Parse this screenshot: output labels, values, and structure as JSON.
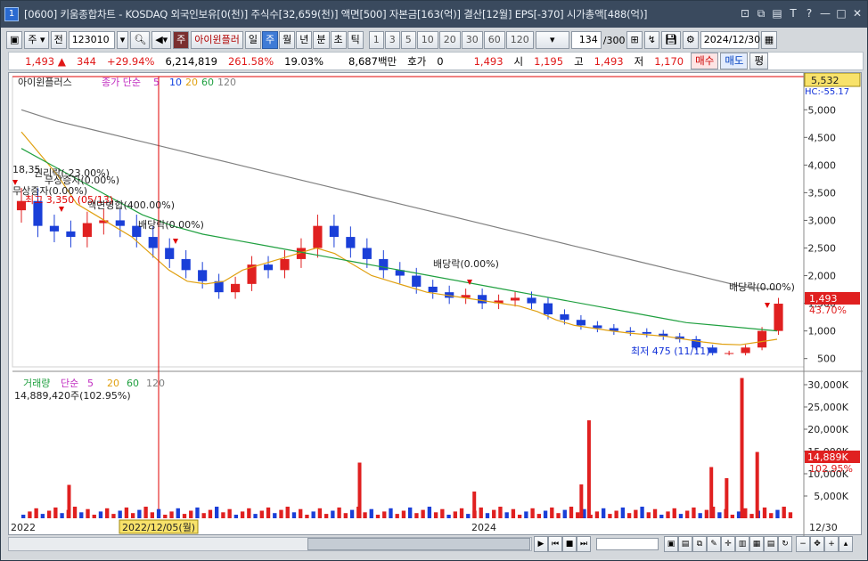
{
  "window": {
    "title": "[0600] 키움종합차트 - KOSDAQ 외국인보유[0(천)] 주식수[32,659(천)] 액면[500] 자본금[163(억)] 결산[12월] EPS[-370] 시가총액[488(억)]",
    "app_number": "1"
  },
  "toolbar": {
    "period_select": "주",
    "prev_label": "전",
    "code": "123010",
    "stock_name": "아이윈플러",
    "prefix_label": "주",
    "periods": [
      "일",
      "주",
      "월",
      "년",
      "분",
      "초",
      "틱"
    ],
    "selected_period": "주",
    "nums": [
      "1",
      "3",
      "5",
      "10",
      "20",
      "30",
      "60",
      "120"
    ],
    "count": "134",
    "count_total": "/300",
    "date": "2024/12/30"
  },
  "quote": {
    "price": "1,493",
    "change": "344",
    "change_pct": "+29.94%",
    "volume": "6,214,819",
    "vol_ratio": "261.58%",
    "turnover": "19.03%",
    "amount": "8,687백만",
    "hoga_label": "호가",
    "hoga_value": "0",
    "hoga_price": "1,493",
    "open_label": "시",
    "open": "1,195",
    "high_label": "고",
    "high": "1,493",
    "low_label": "저",
    "low": "1,170",
    "buy_label": "매수",
    "sell_label": "매도",
    "avg_label": "평"
  },
  "price_panel": {
    "legend_name": "아이윈플러스",
    "legend_ma": "종가 단순",
    "ma_periods": [
      "5",
      "10",
      "20",
      "60",
      "120"
    ],
    "ma_colors": [
      "#c02cc0",
      "#1040e0",
      "#e0a010",
      "#20a040",
      "#808080"
    ],
    "top_right_value": "5,532",
    "hc_label": "HC:-55.17",
    "current_price_tag": "1,493",
    "current_pct_tag": "43.70%",
    "annotations": [
      {
        "text": "18,35"
      },
      {
        "text": "권리락(-23.00%)"
      },
      {
        "text": "무상증자(0.00%)"
      },
      {
        "text": "무상증자(0.00%)"
      },
      {
        "text": "최고 3,350 (05/13)"
      },
      {
        "text": "액면병합(400.00%)"
      },
      {
        "text": "배당락(0.00%)"
      },
      {
        "text": "배당락(0.00%)"
      },
      {
        "text": "배당락(0.00%)"
      },
      {
        "text": "최저 475 (11/11)"
      }
    ]
  },
  "volume_panel": {
    "legend_name": "거래량",
    "legend_ma": "단순",
    "ma_periods": [
      "5",
      "20",
      "60",
      "120"
    ],
    "ma_colors": [
      "#c02cc0",
      "#e0a010",
      "#20a040",
      "#808080"
    ],
    "current_value_text": "14,889,420주(102.95%)",
    "current_tag": "14,889K",
    "current_pct_tag": "102.95%"
  },
  "x_axis": {
    "labels": [
      "2022",
      "2024"
    ],
    "cursor_date": "2022/12/05(월)",
    "right_date": "12/30"
  },
  "chart_data": [
    {
      "type": "candlestick",
      "title": "아이윈플러스 주봉",
      "y_ticks": [
        500,
        1000,
        1500,
        2000,
        2500,
        3000,
        3500,
        4000,
        4500,
        5000
      ],
      "y_tick_labels": [
        "500",
        "1,000",
        "1,500",
        "2,000",
        "2,500",
        "3,000",
        "3,500",
        "4,000",
        "4,500",
        "5,000"
      ],
      "ylim": [
        350,
        5600
      ],
      "series": [
        {
          "name": "종가",
          "values": [
            3350,
            2900,
            2800,
            2700,
            2950,
            3000,
            2900,
            2700,
            2500,
            2300,
            2100,
            1900,
            1700,
            1850,
            2200,
            2100,
            2300,
            2500,
            2900,
            2700,
            2500,
            2300,
            2100,
            2000,
            1800,
            1700,
            1600,
            1650,
            1500,
            1550,
            1600,
            1500,
            1300,
            1200,
            1100,
            1050,
            1000,
            980,
            950,
            900,
            850,
            700,
            600,
            600,
            700,
            1000,
            1493
          ]
        },
        {
          "name": "MA20",
          "values": [
            4600,
            4200,
            3800,
            3300,
            3100,
            2900,
            2700,
            2400,
            2100,
            1900,
            1850,
            1900,
            2100,
            2200,
            2300,
            2400,
            2500,
            2400,
            2200,
            2000,
            1900,
            1800,
            1700,
            1650,
            1600,
            1550,
            1500,
            1450,
            1350,
            1200,
            1100,
            1050,
            1000,
            960,
            930,
            900,
            850,
            800,
            760,
            750,
            800,
            850
          ]
        },
        {
          "name": "MA60",
          "values": [
            4300,
            4000,
            3700,
            3400,
            3100,
            2900,
            2750,
            2650,
            2550,
            2450,
            2350,
            2250,
            2150,
            2050,
            1950,
            1850,
            1750,
            1650,
            1550,
            1450,
            1350,
            1250,
            1150,
            1100,
            1050,
            1000
          ]
        },
        {
          "name": "MA120",
          "values": [
            5000,
            4800,
            4650,
            4500,
            4350,
            4200,
            4050,
            3900,
            3750,
            3600,
            3450,
            3300,
            3150,
            3000,
            2850,
            2700,
            2550,
            2400,
            2250,
            2100,
            1950,
            1800,
            1750
          ]
        }
      ]
    },
    {
      "type": "bar",
      "title": "거래량",
      "y_ticks": [
        5000,
        10000,
        15000,
        20000,
        25000,
        30000
      ],
      "y_tick_labels": [
        "5,000K",
        "10,000K",
        "15,000K",
        "20,000K",
        "25,000K",
        "30,000K"
      ],
      "ylim": [
        0,
        32000
      ],
      "spikes": [
        {
          "pos": 0.06,
          "value": 7500
        },
        {
          "pos": 0.44,
          "value": 12500
        },
        {
          "pos": 0.59,
          "value": 6000
        },
        {
          "pos": 0.73,
          "value": 7600
        },
        {
          "pos": 0.74,
          "value": 22000
        },
        {
          "pos": 0.9,
          "value": 11500
        },
        {
          "pos": 0.92,
          "value": 9000
        },
        {
          "pos": 0.94,
          "value": 31500
        },
        {
          "pos": 0.96,
          "value": 14889
        }
      ]
    }
  ]
}
